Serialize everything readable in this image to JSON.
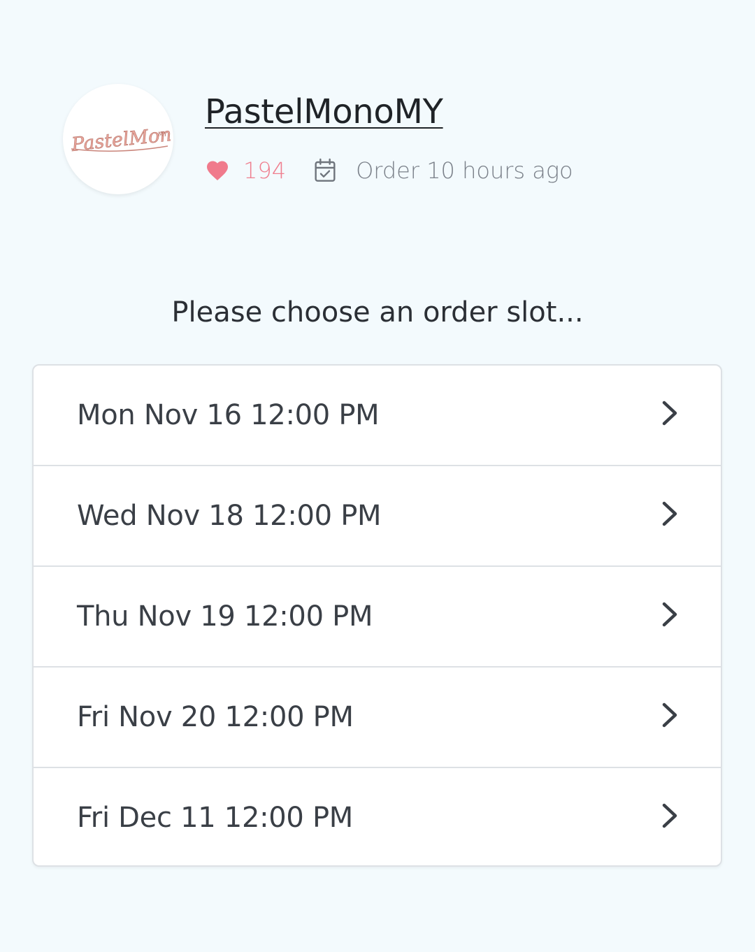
{
  "shop": {
    "name": "PastelMonoMY",
    "logo_text": "PastelMono",
    "likes": "194",
    "order_status": "Order 10 hours ago"
  },
  "prompt": "Please choose an order slot...",
  "slots": [
    {
      "label": "Mon Nov 16 12:00 PM"
    },
    {
      "label": "Wed Nov 18 12:00 PM"
    },
    {
      "label": "Thu Nov 19 12:00 PM"
    },
    {
      "label": "Fri Nov 20 12:00 PM"
    },
    {
      "label": "Fri Dec 11 12:00 PM"
    }
  ],
  "icons": {
    "likes": "heart-icon",
    "order": "calendar-check-icon",
    "slot_arrow": "chevron-right-icon"
  },
  "colors": {
    "background": "#f3fafd",
    "heart": "#f07a8c",
    "text_dark": "#2f343b",
    "text_muted": "#7a8089",
    "logo_pink": "#e8a49a"
  }
}
